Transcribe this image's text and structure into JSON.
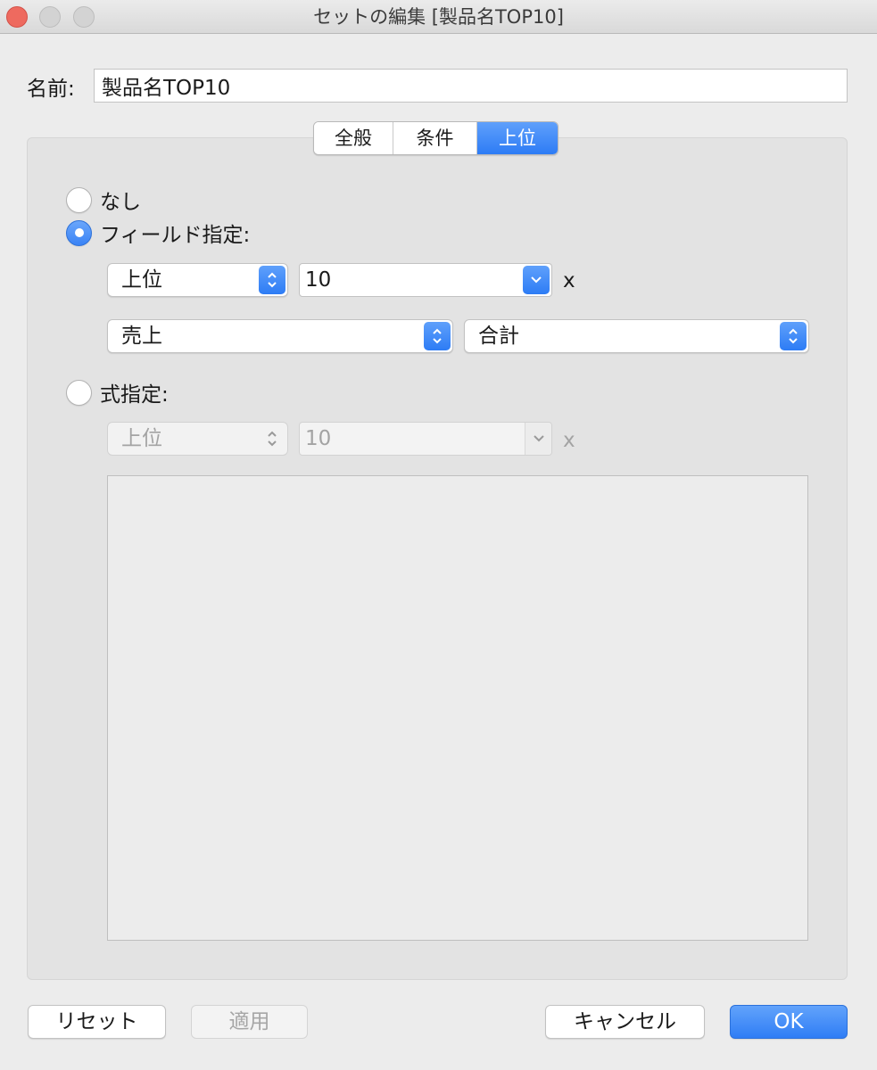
{
  "window": {
    "title": "セットの編集 [製品名TOP10]",
    "traffic_lights": [
      "close",
      "minimize",
      "zoom"
    ]
  },
  "name_field": {
    "label": "名前:",
    "value": "製品名TOP10"
  },
  "tabs": [
    {
      "label": "全般",
      "active": false
    },
    {
      "label": "条件",
      "active": false
    },
    {
      "label": "上位",
      "active": true
    }
  ],
  "top": {
    "radio_none": {
      "label": "なし",
      "checked": false
    },
    "radio_field": {
      "label": "フィールド指定:",
      "checked": true
    },
    "field": {
      "direction": "上位",
      "count": "10",
      "x_label": "x",
      "by_field": "売上",
      "aggregation": "合計"
    },
    "radio_formula": {
      "label": "式指定:",
      "checked": false
    },
    "formula": {
      "direction": "上位",
      "count": "10",
      "x_label": "x",
      "text": ""
    }
  },
  "buttons": {
    "reset": "リセット",
    "apply": "適用",
    "cancel": "キャンセル",
    "ok": "OK"
  },
  "colors": {
    "accent": "#2d7cf5",
    "close": "#ee6a5f",
    "window_bg": "#ececec"
  }
}
